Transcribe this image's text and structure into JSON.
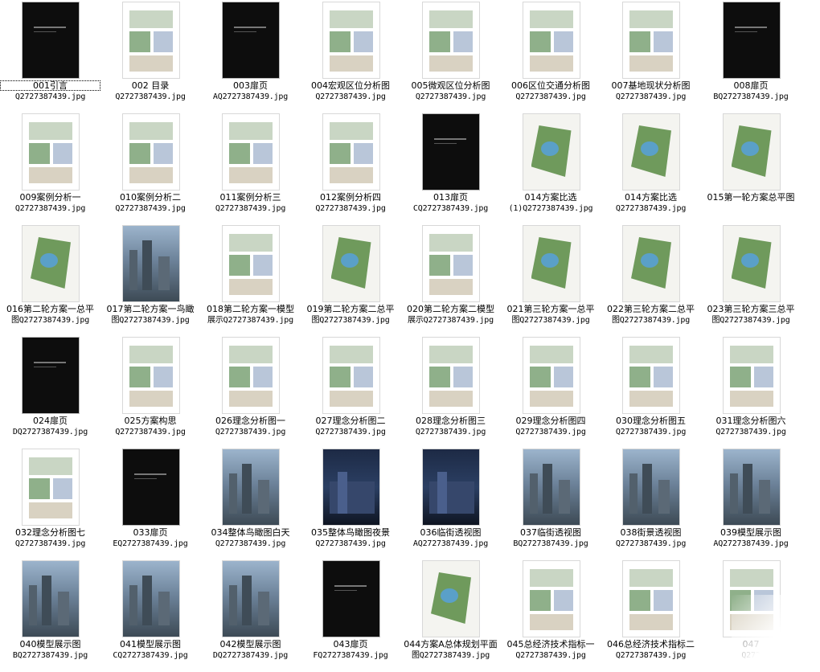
{
  "items": [
    {
      "label": "001引言",
      "file": "Q2727387439.jpg",
      "style": "dark"
    },
    {
      "label": "002 目录",
      "file": "Q2727387439.jpg",
      "style": "light"
    },
    {
      "label": "003扉页",
      "file": "AQ2727387439.jpg",
      "style": "dark"
    },
    {
      "label": "004宏观区位分析图",
      "file": "Q2727387439.jpg",
      "style": "light"
    },
    {
      "label": "005微观区位分析图",
      "file": "Q2727387439.jpg",
      "style": "light"
    },
    {
      "label": "006区位交通分析图",
      "file": "Q2727387439.jpg",
      "style": "light"
    },
    {
      "label": "007基地现状分析图",
      "file": "Q2727387439.jpg",
      "style": "light"
    },
    {
      "label": "008扉页",
      "file": "BQ2727387439.jpg",
      "style": "dark"
    },
    {
      "label": "009案例分析一",
      "file": "Q2727387439.jpg",
      "style": "light"
    },
    {
      "label": "010案例分析二",
      "file": "Q2727387439.jpg",
      "style": "light"
    },
    {
      "label": "011案例分析三",
      "file": "Q2727387439.jpg",
      "style": "light"
    },
    {
      "label": "012案例分析四",
      "file": "Q2727387439.jpg",
      "style": "light"
    },
    {
      "label": "013扉页",
      "file": "CQ2727387439.jpg",
      "style": "dark"
    },
    {
      "label": "014方案比选",
      "file": "(1)Q2727387439.jpg",
      "style": "plan"
    },
    {
      "label": "014方案比选",
      "file": "Q2727387439.jpg",
      "style": "plan"
    },
    {
      "label": "015第一轮方案总平图",
      "file": "",
      "style": "plan"
    },
    {
      "label": "016第二轮方案一总平",
      "file": "图Q2727387439.jpg",
      "style": "plan"
    },
    {
      "label": "017第二轮方案一鸟瞰",
      "file": "图Q2727387439.jpg",
      "style": "photo"
    },
    {
      "label": "018第二轮方案一模型",
      "file": "展示Q2727387439.jpg",
      "style": "light"
    },
    {
      "label": "019第二轮方案二总平",
      "file": "图Q2727387439.jpg",
      "style": "plan"
    },
    {
      "label": "020第二轮方案二模型",
      "file": "展示Q2727387439.jpg",
      "style": "light"
    },
    {
      "label": "021第三轮方案一总平",
      "file": "图Q2727387439.jpg",
      "style": "plan"
    },
    {
      "label": "022第三轮方案二总平",
      "file": "图Q2727387439.jpg",
      "style": "plan"
    },
    {
      "label": "023第三轮方案三总平",
      "file": "图Q2727387439.jpg",
      "style": "plan"
    },
    {
      "label": "024扉页",
      "file": "DQ2727387439.jpg",
      "style": "dark"
    },
    {
      "label": "025方案构思",
      "file": "Q2727387439.jpg",
      "style": "light"
    },
    {
      "label": "026理念分析图一",
      "file": "Q2727387439.jpg",
      "style": "light"
    },
    {
      "label": "027理念分析图二",
      "file": "Q2727387439.jpg",
      "style": "light"
    },
    {
      "label": "028理念分析图三",
      "file": "Q2727387439.jpg",
      "style": "light"
    },
    {
      "label": "029理念分析图四",
      "file": "Q2727387439.jpg",
      "style": "light"
    },
    {
      "label": "030理念分析图五",
      "file": "Q2727387439.jpg",
      "style": "light"
    },
    {
      "label": "031理念分析图六",
      "file": "Q2727387439.jpg",
      "style": "light"
    },
    {
      "label": "032理念分析图七",
      "file": "Q2727387439.jpg",
      "style": "light"
    },
    {
      "label": "033扉页",
      "file": "EQ2727387439.jpg",
      "style": "dark"
    },
    {
      "label": "034整体鸟瞰图白天",
      "file": "Q2727387439.jpg",
      "style": "photo"
    },
    {
      "label": "035整体鸟瞰图夜景",
      "file": "Q2727387439.jpg",
      "style": "night"
    },
    {
      "label": "036临街透视图",
      "file": "AQ2727387439.jpg",
      "style": "night"
    },
    {
      "label": "037临街透视图",
      "file": "BQ2727387439.jpg",
      "style": "photo"
    },
    {
      "label": "038街景透视图",
      "file": "Q2727387439.jpg",
      "style": "photo"
    },
    {
      "label": "039模型展示图",
      "file": "AQ2727387439.jpg",
      "style": "photo"
    },
    {
      "label": "040模型展示图",
      "file": "BQ2727387439.jpg",
      "style": "photo"
    },
    {
      "label": "041模型展示图",
      "file": "CQ2727387439.jpg",
      "style": "photo"
    },
    {
      "label": "042模型展示图",
      "file": "DQ2727387439.jpg",
      "style": "photo"
    },
    {
      "label": "043扉页",
      "file": "FQ2727387439.jpg",
      "style": "dark"
    },
    {
      "label": "044方案A总体规划平面",
      "file": "图Q2727387439.jpg",
      "style": "plan"
    },
    {
      "label": "045总经济技术指标一",
      "file": "Q2727387439.jpg",
      "style": "light"
    },
    {
      "label": "046总经济技术指标二",
      "file": "Q2727387439.jpg",
      "style": "light"
    },
    {
      "label": "047",
      "file": "Q272",
      "style": "light"
    }
  ],
  "selected_index": 0
}
